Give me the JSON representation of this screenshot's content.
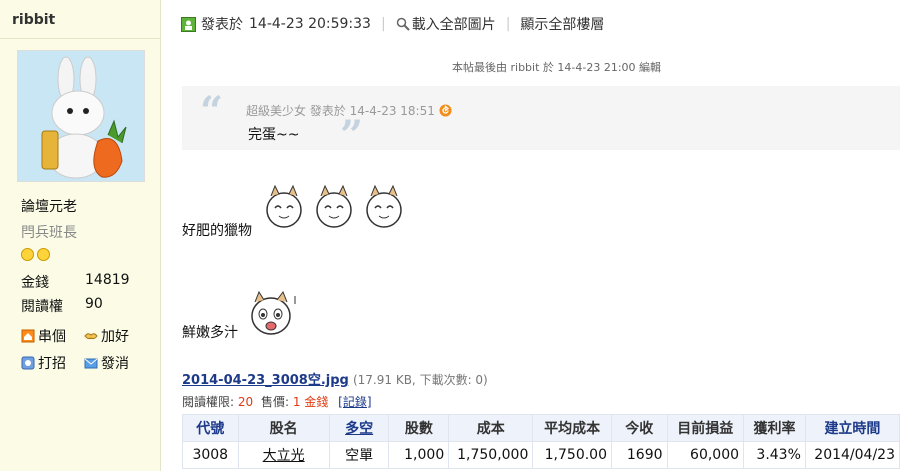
{
  "sidebar": {
    "username": "ribbit",
    "rank": "論壇元老",
    "title": "閂兵班長",
    "stats": [
      {
        "label": "金錢",
        "value": "14819"
      },
      {
        "label": "閱讀權",
        "value": "90"
      }
    ],
    "actions": [
      {
        "label": "串個",
        "icon": "home-icon"
      },
      {
        "label": "加好",
        "icon": "handshake-icon"
      },
      {
        "label": "打招",
        "icon": "wave-icon"
      },
      {
        "label": "發消",
        "icon": "mail-icon"
      }
    ]
  },
  "post": {
    "published_prefix": "發表於",
    "published_time": "14-4-23 20:59:33",
    "load_images": "載入全部圖片",
    "show_all": "顯示全部樓層",
    "edit_note": "本帖最後由 ribbit 於 14-4-23 21:00 編輯",
    "quote": {
      "author_line": "超級美少女 發表於 14-4-23 18:51",
      "text": "完蛋~~"
    },
    "line1": "好肥的獵物",
    "line2": "鮮嫩多汁",
    "attachment": {
      "filename": "2014-04-23_3008空.jpg",
      "meta": "(17.91 KB, 下載次數: 0)"
    },
    "permission": {
      "label": "閱讀權限:",
      "level": "20",
      "price_label": "售價:",
      "price": "1 金錢",
      "record": "[記錄]"
    }
  },
  "table": {
    "headers": [
      "代號",
      "股名",
      "多空",
      "股數",
      "成本",
      "平均成本",
      "今收",
      "目前損益",
      "獲利率",
      "建立時間"
    ],
    "row": [
      "3008",
      "大立光",
      "空單",
      "1,000",
      "1,750,000",
      "1,750.00",
      "1690",
      "60,000",
      "3.43%",
      "2014/04/23"
    ]
  },
  "colors": {
    "sidebar_bg": "#fbfbe6",
    "link": "#1d3a8a",
    "accent_red": "#e03a12",
    "table_header_bg": "#eef2fa"
  }
}
